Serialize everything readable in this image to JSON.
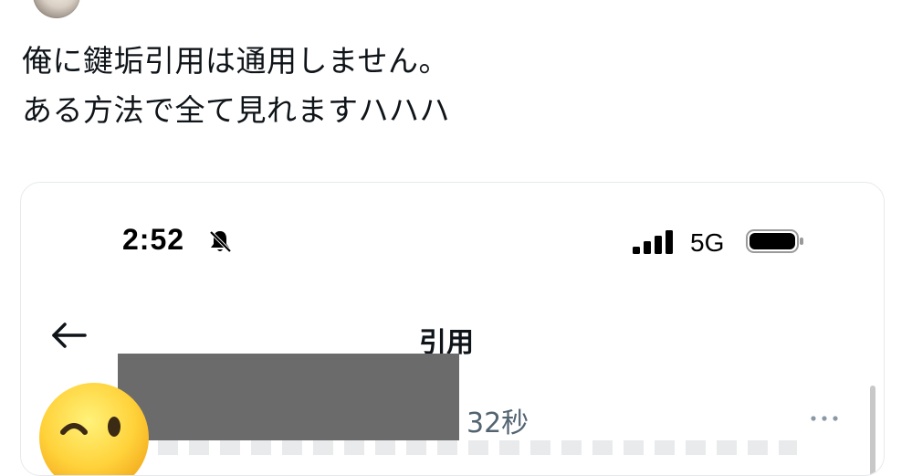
{
  "tweet": {
    "lines": [
      "俺に鍵垢引用は通用しません。",
      "ある方法で全て見れますハハハ"
    ]
  },
  "phone_screenshot": {
    "status_bar": {
      "time": "2:52",
      "network": "5G",
      "icons": [
        "bell-muted-icon",
        "signal-icon",
        "battery-icon"
      ]
    },
    "header": {
      "title": "引用",
      "back_icon": "arrow-left-icon"
    },
    "post": {
      "timestamp": "32秒",
      "more_icon": "ellipsis-icon",
      "avatar_icon": "winking-face-emoji"
    }
  },
  "colors": {
    "text_primary": "#0f1419",
    "text_secondary": "#536471",
    "card_border": "#e6e9eb",
    "redaction": "#6b6b6b"
  }
}
